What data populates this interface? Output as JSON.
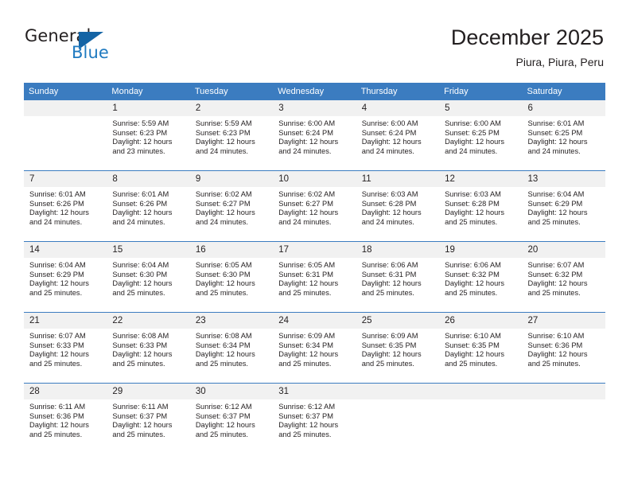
{
  "brand": {
    "name_part1": "General",
    "name_part2": "Blue",
    "triangle_color": "#1464a5",
    "blue_text_color": "#1f7ac0"
  },
  "header": {
    "title": "December 2025",
    "location": "Piura, Piura, Peru"
  },
  "theme": {
    "header_blue": "#3b7cc0",
    "daynum_band": "#f1f1f1",
    "text": "#231f20"
  },
  "weekdays": [
    "Sunday",
    "Monday",
    "Tuesday",
    "Wednesday",
    "Thursday",
    "Friday",
    "Saturday"
  ],
  "weeks": [
    [
      {
        "day": "",
        "lines": []
      },
      {
        "day": "1",
        "lines": [
          "Sunrise: 5:59 AM",
          "Sunset: 6:23 PM",
          "Daylight: 12 hours",
          "and 23 minutes."
        ]
      },
      {
        "day": "2",
        "lines": [
          "Sunrise: 5:59 AM",
          "Sunset: 6:23 PM",
          "Daylight: 12 hours",
          "and 24 minutes."
        ]
      },
      {
        "day": "3",
        "lines": [
          "Sunrise: 6:00 AM",
          "Sunset: 6:24 PM",
          "Daylight: 12 hours",
          "and 24 minutes."
        ]
      },
      {
        "day": "4",
        "lines": [
          "Sunrise: 6:00 AM",
          "Sunset: 6:24 PM",
          "Daylight: 12 hours",
          "and 24 minutes."
        ]
      },
      {
        "day": "5",
        "lines": [
          "Sunrise: 6:00 AM",
          "Sunset: 6:25 PM",
          "Daylight: 12 hours",
          "and 24 minutes."
        ]
      },
      {
        "day": "6",
        "lines": [
          "Sunrise: 6:01 AM",
          "Sunset: 6:25 PM",
          "Daylight: 12 hours",
          "and 24 minutes."
        ]
      }
    ],
    [
      {
        "day": "7",
        "lines": [
          "Sunrise: 6:01 AM",
          "Sunset: 6:26 PM",
          "Daylight: 12 hours",
          "and 24 minutes."
        ]
      },
      {
        "day": "8",
        "lines": [
          "Sunrise: 6:01 AM",
          "Sunset: 6:26 PM",
          "Daylight: 12 hours",
          "and 24 minutes."
        ]
      },
      {
        "day": "9",
        "lines": [
          "Sunrise: 6:02 AM",
          "Sunset: 6:27 PM",
          "Daylight: 12 hours",
          "and 24 minutes."
        ]
      },
      {
        "day": "10",
        "lines": [
          "Sunrise: 6:02 AM",
          "Sunset: 6:27 PM",
          "Daylight: 12 hours",
          "and 24 minutes."
        ]
      },
      {
        "day": "11",
        "lines": [
          "Sunrise: 6:03 AM",
          "Sunset: 6:28 PM",
          "Daylight: 12 hours",
          "and 24 minutes."
        ]
      },
      {
        "day": "12",
        "lines": [
          "Sunrise: 6:03 AM",
          "Sunset: 6:28 PM",
          "Daylight: 12 hours",
          "and 25 minutes."
        ]
      },
      {
        "day": "13",
        "lines": [
          "Sunrise: 6:04 AM",
          "Sunset: 6:29 PM",
          "Daylight: 12 hours",
          "and 25 minutes."
        ]
      }
    ],
    [
      {
        "day": "14",
        "lines": [
          "Sunrise: 6:04 AM",
          "Sunset: 6:29 PM",
          "Daylight: 12 hours",
          "and 25 minutes."
        ]
      },
      {
        "day": "15",
        "lines": [
          "Sunrise: 6:04 AM",
          "Sunset: 6:30 PM",
          "Daylight: 12 hours",
          "and 25 minutes."
        ]
      },
      {
        "day": "16",
        "lines": [
          "Sunrise: 6:05 AM",
          "Sunset: 6:30 PM",
          "Daylight: 12 hours",
          "and 25 minutes."
        ]
      },
      {
        "day": "17",
        "lines": [
          "Sunrise: 6:05 AM",
          "Sunset: 6:31 PM",
          "Daylight: 12 hours",
          "and 25 minutes."
        ]
      },
      {
        "day": "18",
        "lines": [
          "Sunrise: 6:06 AM",
          "Sunset: 6:31 PM",
          "Daylight: 12 hours",
          "and 25 minutes."
        ]
      },
      {
        "day": "19",
        "lines": [
          "Sunrise: 6:06 AM",
          "Sunset: 6:32 PM",
          "Daylight: 12 hours",
          "and 25 minutes."
        ]
      },
      {
        "day": "20",
        "lines": [
          "Sunrise: 6:07 AM",
          "Sunset: 6:32 PM",
          "Daylight: 12 hours",
          "and 25 minutes."
        ]
      }
    ],
    [
      {
        "day": "21",
        "lines": [
          "Sunrise: 6:07 AM",
          "Sunset: 6:33 PM",
          "Daylight: 12 hours",
          "and 25 minutes."
        ]
      },
      {
        "day": "22",
        "lines": [
          "Sunrise: 6:08 AM",
          "Sunset: 6:33 PM",
          "Daylight: 12 hours",
          "and 25 minutes."
        ]
      },
      {
        "day": "23",
        "lines": [
          "Sunrise: 6:08 AM",
          "Sunset: 6:34 PM",
          "Daylight: 12 hours",
          "and 25 minutes."
        ]
      },
      {
        "day": "24",
        "lines": [
          "Sunrise: 6:09 AM",
          "Sunset: 6:34 PM",
          "Daylight: 12 hours",
          "and 25 minutes."
        ]
      },
      {
        "day": "25",
        "lines": [
          "Sunrise: 6:09 AM",
          "Sunset: 6:35 PM",
          "Daylight: 12 hours",
          "and 25 minutes."
        ]
      },
      {
        "day": "26",
        "lines": [
          "Sunrise: 6:10 AM",
          "Sunset: 6:35 PM",
          "Daylight: 12 hours",
          "and 25 minutes."
        ]
      },
      {
        "day": "27",
        "lines": [
          "Sunrise: 6:10 AM",
          "Sunset: 6:36 PM",
          "Daylight: 12 hours",
          "and 25 minutes."
        ]
      }
    ],
    [
      {
        "day": "28",
        "lines": [
          "Sunrise: 6:11 AM",
          "Sunset: 6:36 PM",
          "Daylight: 12 hours",
          "and 25 minutes."
        ]
      },
      {
        "day": "29",
        "lines": [
          "Sunrise: 6:11 AM",
          "Sunset: 6:37 PM",
          "Daylight: 12 hours",
          "and 25 minutes."
        ]
      },
      {
        "day": "30",
        "lines": [
          "Sunrise: 6:12 AM",
          "Sunset: 6:37 PM",
          "Daylight: 12 hours",
          "and 25 minutes."
        ]
      },
      {
        "day": "31",
        "lines": [
          "Sunrise: 6:12 AM",
          "Sunset: 6:37 PM",
          "Daylight: 12 hours",
          "and 25 minutes."
        ]
      },
      {
        "day": "",
        "lines": []
      },
      {
        "day": "",
        "lines": []
      },
      {
        "day": "",
        "lines": []
      }
    ]
  ]
}
